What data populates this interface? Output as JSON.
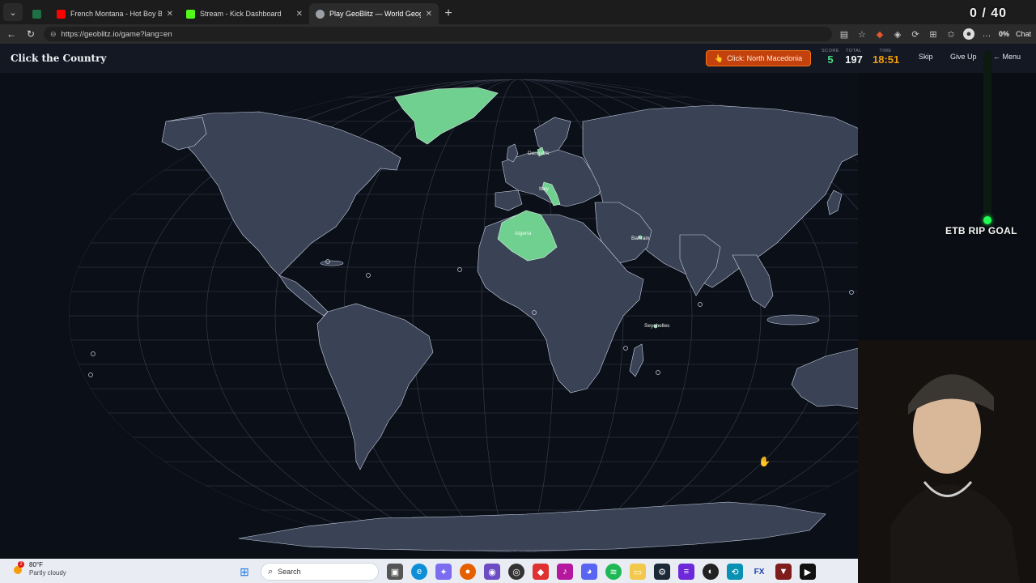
{
  "browser": {
    "tabs": [
      {
        "label": "French Montana - Hot Boy Bling ft",
        "color": "#ff0000"
      },
      {
        "label": "Stream - Kick Dashboard",
        "color": "#53fc18"
      },
      {
        "label": "Play GeoBlitz — World Geography",
        "color": "#9aa0a6",
        "active": true
      }
    ],
    "new_tab": "+",
    "url": "https://geoblitz.io/game?lang=en",
    "chat_label": "Chat",
    "zoom": "0%"
  },
  "overlay": {
    "counter": "0 / 40",
    "goal_label": "ETB RIP GOAL"
  },
  "game": {
    "title": "Click the Country",
    "prompt": "Click: North Macedonia",
    "score_label": "SCORE",
    "score": "5",
    "total_label": "TOTAL",
    "total": "197",
    "time_label": "TIME",
    "time": "18:51",
    "skip": "Skip",
    "give_up": "Give Up",
    "menu": "← Menu",
    "accent": "#f97316",
    "score_color": "#4ade80",
    "time_color": "#f59e0b",
    "found_color": "#6fd08f",
    "labels": {
      "denmark": "Denmark",
      "italy": "Italy",
      "algeria": "Algeria",
      "bahrain": "Bahrain",
      "seychelles": "Seychelles"
    }
  },
  "taskbar": {
    "weather_temp": "80°F",
    "weather_desc": "Partly cloudy",
    "weather_badge": "2",
    "search_placeholder": "Search",
    "apps": [
      "windows-icon",
      "search-icon",
      "file-explorer-icon",
      "edge-icon",
      "copilot-icon",
      "firefox-icon",
      "chat-icon",
      "chrome-icon",
      "app-icon",
      "itunes-icon",
      "discord-icon",
      "spotify-icon",
      "folder-icon",
      "steam-icon",
      "media-icon",
      "obs-icon",
      "settings-icon",
      "fx-icon",
      "game-icon",
      "terminal-icon"
    ]
  }
}
